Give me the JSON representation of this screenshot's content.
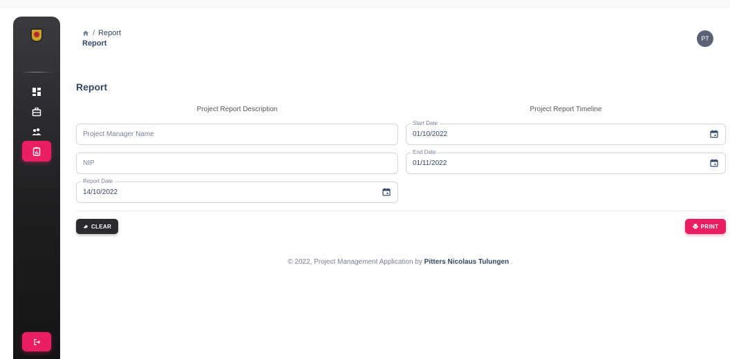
{
  "sidebar": {
    "items": [
      {
        "icon": "dashboard-icon",
        "label": "Dashboard"
      },
      {
        "icon": "briefcase-icon",
        "label": "Projects"
      },
      {
        "icon": "users-icon",
        "label": "Users"
      },
      {
        "icon": "clipboard-report-icon",
        "label": "Report",
        "active": true
      }
    ],
    "logout_icon": "logout-icon",
    "accent": "#e91e63"
  },
  "header": {
    "breadcrumb_sep": "/",
    "breadcrumb_current": "Report",
    "title": "Report",
    "avatar_initials": "PT"
  },
  "main": {
    "title": "Report",
    "left_heading": "Project Report Description",
    "right_heading": "Project Report Timeline",
    "fields": {
      "manager_name_placeholder": "Project Manager Name",
      "nip_placeholder": "NIP",
      "report_date_label": "Report Date",
      "report_date_value": "14/10/2022",
      "start_date_label": "Start Date",
      "start_date_value": "01/10/2022",
      "end_date_label": "End Date",
      "end_date_value": "01/11/2022"
    },
    "buttons": {
      "clear_label": "CLEAR",
      "print_label": "PRINT"
    }
  },
  "footer": {
    "text": "© 2022, Project Management Application by",
    "author": "Pitters Nicolaus Tulungen",
    "suffix": "."
  }
}
